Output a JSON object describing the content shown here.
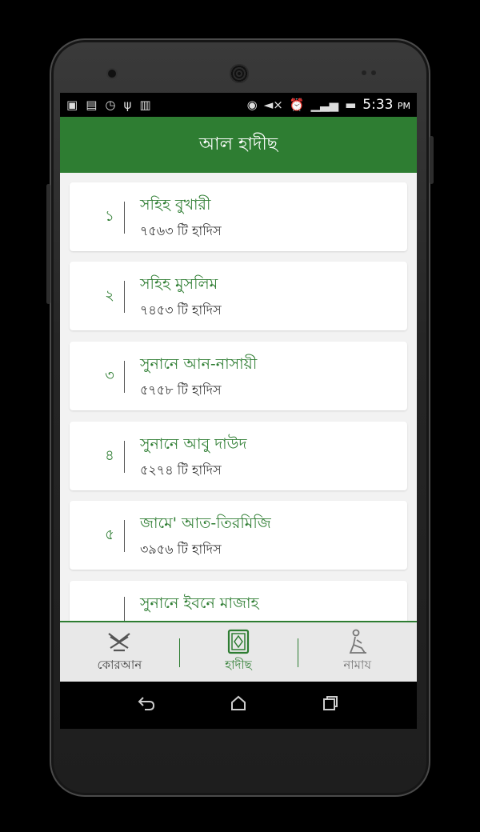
{
  "status_bar": {
    "left_icons": [
      "photo-icon",
      "keyboard-icon",
      "clock-icon",
      "usb-icon",
      "barcode-icon"
    ],
    "right_icons": [
      "nfc-icon",
      "mute-icon",
      "alarm-icon",
      "signal-icon",
      "battery-icon"
    ],
    "time": "5:33",
    "ampm": "PM"
  },
  "app_bar": {
    "title": "আল হাদীছ"
  },
  "books": [
    {
      "num": "১",
      "title": "সহিহ বুখারী",
      "count": "৭৫৬৩ টি হাদিস"
    },
    {
      "num": "২",
      "title": "সহিহ মুসলিম",
      "count": "৭৪৫৩ টি হাদিস"
    },
    {
      "num": "৩",
      "title": "সুনানে আন-নাসায়ী",
      "count": "৫৭৫৮ টি হাদিস"
    },
    {
      "num": "৪",
      "title": "সুনানে আবু দাউদ",
      "count": "৫২৭৪ টি হাদিস"
    },
    {
      "num": "৫",
      "title": "জামে' আত-তিরমিজি",
      "count": "৩৯৫৬ টি হাদিস"
    },
    {
      "num": "",
      "title": "সুনানে ইবনে মাজাহ",
      "count": ""
    }
  ],
  "bottom_nav": [
    {
      "label": "কোরআন",
      "icon": "quran-stand-icon",
      "state": "normal"
    },
    {
      "label": "হাদীছ",
      "icon": "book-icon",
      "state": "active"
    },
    {
      "label": "নামায",
      "icon": "praying-person-icon",
      "state": "dim"
    }
  ],
  "system_nav": {
    "back": "back-icon",
    "home": "home-icon",
    "recents": "recents-icon"
  },
  "colors": {
    "primary": "#2e7d32",
    "background": "#f2f2f2"
  }
}
